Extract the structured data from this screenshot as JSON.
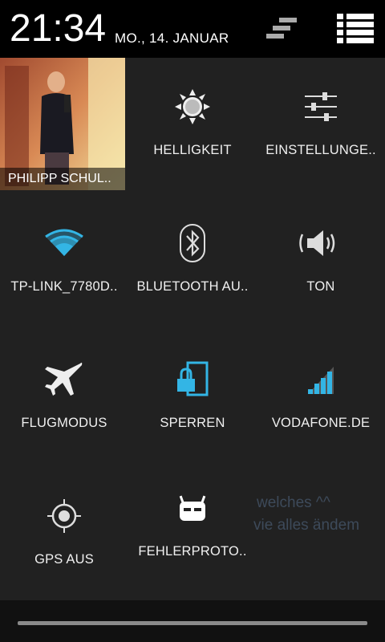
{
  "status_bar": {
    "time": "21:34",
    "date": "MO., 14. JANUAR",
    "icons": [
      "notifications-dismiss-icon",
      "settings-list-icon"
    ]
  },
  "profile": {
    "name": "PHILIPP SCHUL.."
  },
  "tiles": [
    {
      "label": "HELLIGKEIT",
      "icon": "brightness-icon"
    },
    {
      "label": "EINSTELLUNGE..",
      "icon": "settings-sliders-icon"
    },
    {
      "label": "TP-LINK_7780D..",
      "icon": "wifi-icon"
    },
    {
      "label": "BLUETOOTH AU..",
      "icon": "bluetooth-icon"
    },
    {
      "label": "TON",
      "icon": "sound-icon"
    },
    {
      "label": "FLUGMODUS",
      "icon": "airplane-icon"
    },
    {
      "label": "SPERREN",
      "icon": "lock-icon"
    },
    {
      "label": "VODAFONE.DE",
      "icon": "signal-icon"
    },
    {
      "label": "GPS AUS",
      "icon": "gps-icon"
    },
    {
      "label": "FEHLERPROTO..",
      "icon": "cyanogenmod-icon"
    }
  ],
  "background_text": {
    "line1": "welches ^^",
    "line2": "vie alles ändem"
  },
  "colors": {
    "accent": "#33b5e5",
    "status_bar": "#000000",
    "panel": "#212121"
  }
}
